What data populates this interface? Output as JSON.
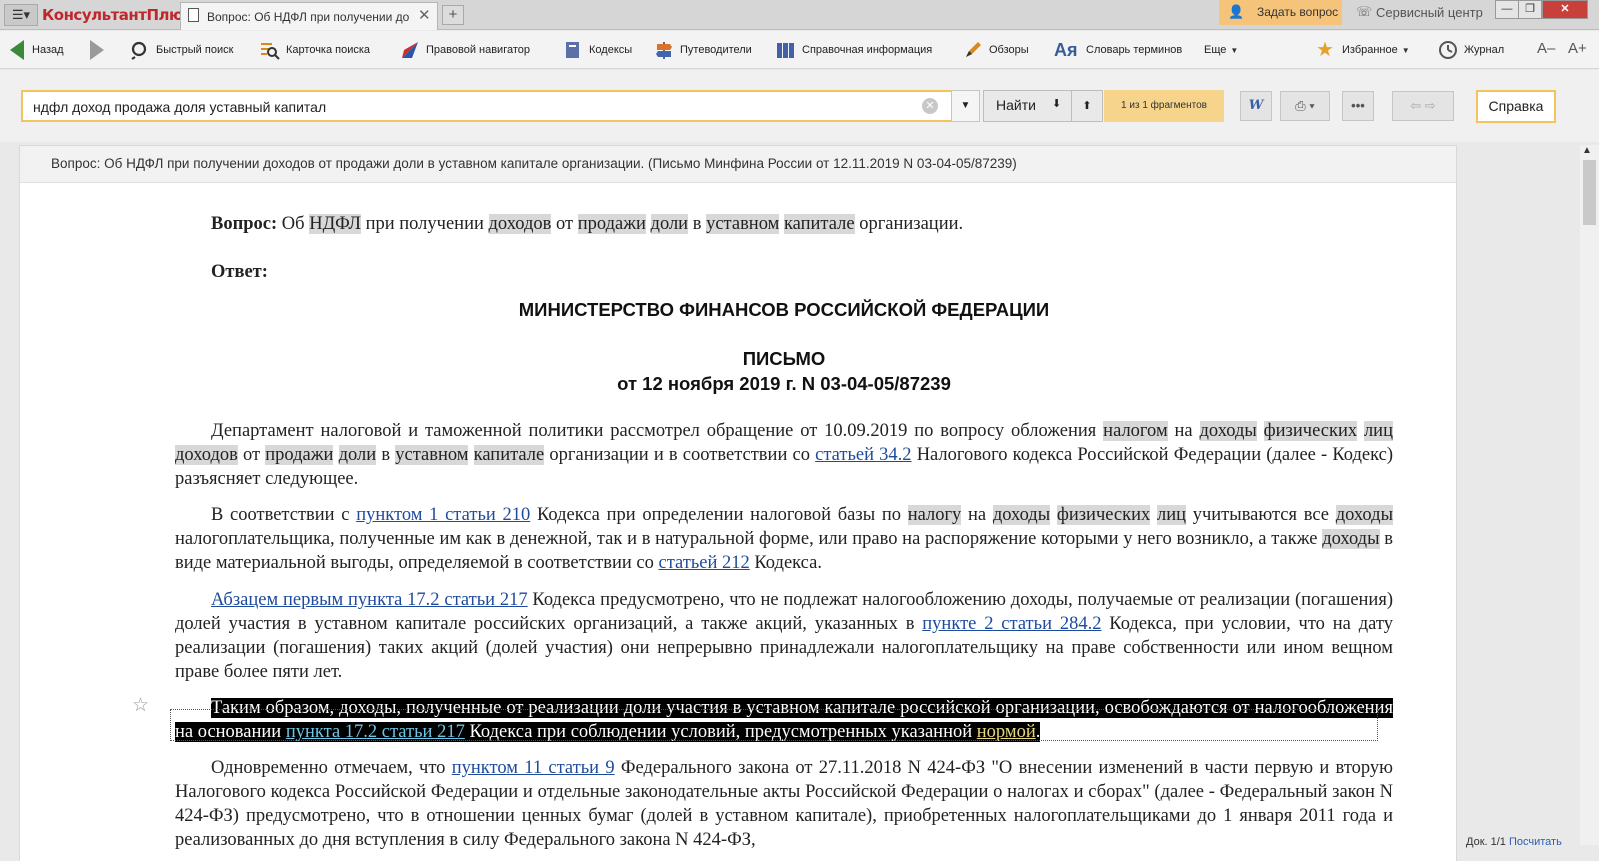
{
  "titlebar": {
    "logo": "КонсультантПлюс",
    "tab_title": "Вопрос: Об НДФЛ при получении до",
    "tab_close": "✕",
    "tab_new": "+",
    "ask_label": "Задать вопрос",
    "service_label": "Сервисный центр"
  },
  "toolbar": {
    "back": "Назад",
    "quick_search": "Быстрый поиск",
    "search_card": "Карточка поиска",
    "legal_navigator": "Правовой навигатор",
    "codes": "Кодексы",
    "guides": "Путеводители",
    "reference": "Справочная информация",
    "reviews": "Обзоры",
    "dictionary": "Словарь терминов",
    "more": "Еще",
    "favorites": "Избранное",
    "journal": "Журнал",
    "font_smaller": "A–",
    "font_larger": "A+"
  },
  "search": {
    "query": "ндфл доход продажа доля уставный капитал",
    "find_label": "Найти",
    "fragments": "1 из 1 фрагментов",
    "help_label": "Справка"
  },
  "document": {
    "header": "Вопрос: Об НДФЛ при получении доходов от продажи доли в уставном капитале организации. (Письмо Минфина России от 12.11.2019 N 03-04-05/87239)",
    "question_label": "Вопрос:",
    "answer_label": "Ответ:",
    "ministry": "МИНИСТЕРСТВО ФИНАНСОВ РОССИЙСКОЙ ФЕДЕРАЦИИ",
    "letter": "ПИСЬМО",
    "letter_date": "от 12 ноября 2019 г. N 03-04-05/87239"
  },
  "status": {
    "doc_prefix": "Док.",
    "doc_count": "1/1",
    "count_link": "Посчитать"
  },
  "colors": {
    "accent": "#f2c35f",
    "link": "#1d4a9e",
    "ask_bg": "#f5c47a"
  }
}
